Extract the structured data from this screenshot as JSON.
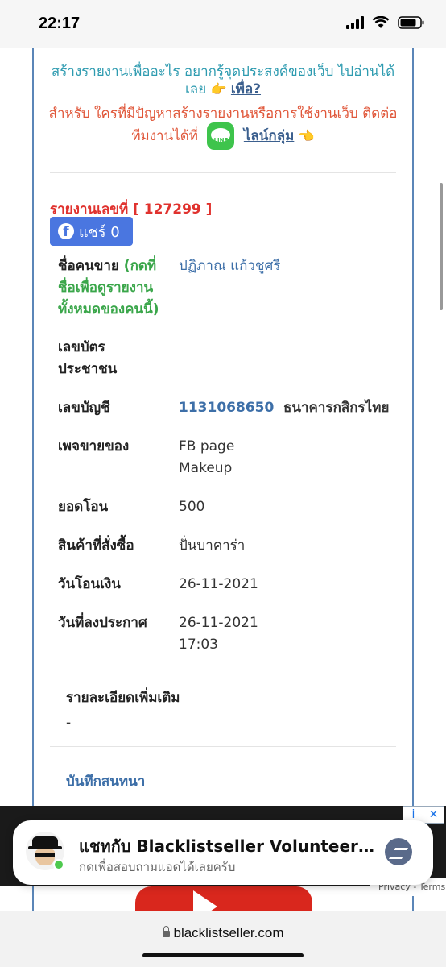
{
  "status_bar": {
    "time": "22:17"
  },
  "intro": {
    "purpose_text": "สร้างรายงานเพื่ออะไร อยากรู้จุดประสงค์ของเว็บ ไปอ่านได้เลย",
    "purpose_link": "เพื่อ?",
    "contact_text": "สำหรับ ใครที่มีปัญหาสร้างรายงานหรือการใช้งานเว็บ ติดต่อทีมงานได้ที่",
    "line_icon_text": "LINE",
    "line_group_link": "ไลน์กลุ่ม"
  },
  "report": {
    "number_label": "รายงานเลขที่ [ 127299 ]",
    "share_label": "แชร์ 0",
    "seller_label": "ชื่อคนขาย",
    "seller_hint": "(กดที่ชื่อเพื่อดูรายงานทั้งหมดของคนนี้)",
    "seller_name": "ปฏิภาณ แก้วชูศรี",
    "id_card_label": "เลขบัตรประชาชน",
    "id_card_value": "",
    "account_label": "เลขบัญชี",
    "account_number": "1131068650",
    "bank_name": "ธนาคารกสิกรไทย",
    "page_label": "เพจขายของ",
    "page_value": "FB page Makeup",
    "amount_label": "ยอดโอน",
    "amount_value": "500",
    "product_label": "สินค้าที่สั่งซื้อ",
    "product_value": "ปั่นบาคาร่า",
    "transfer_date_label": "วันโอนเงิน",
    "transfer_date_value": "26-11-2021",
    "post_date_label": "วันที่ลงประกาศ",
    "post_date_value": "26-11-2021 17:03",
    "more_details_label": "รายละเอียดเพิ่มเติม",
    "more_details_value": "-",
    "chat_log_link": "บันทึกสนทนา"
  },
  "ad": {
    "footer": "Privacy - Terms",
    "info": "i",
    "close": "✕"
  },
  "chat_popup": {
    "title": "แชทกับ Blacklistseller Volunteer Team",
    "subtitle": "กดเพื่อสอบถามแอดได้เลยครับ"
  },
  "browser": {
    "url": "blacklistseller.com"
  }
}
